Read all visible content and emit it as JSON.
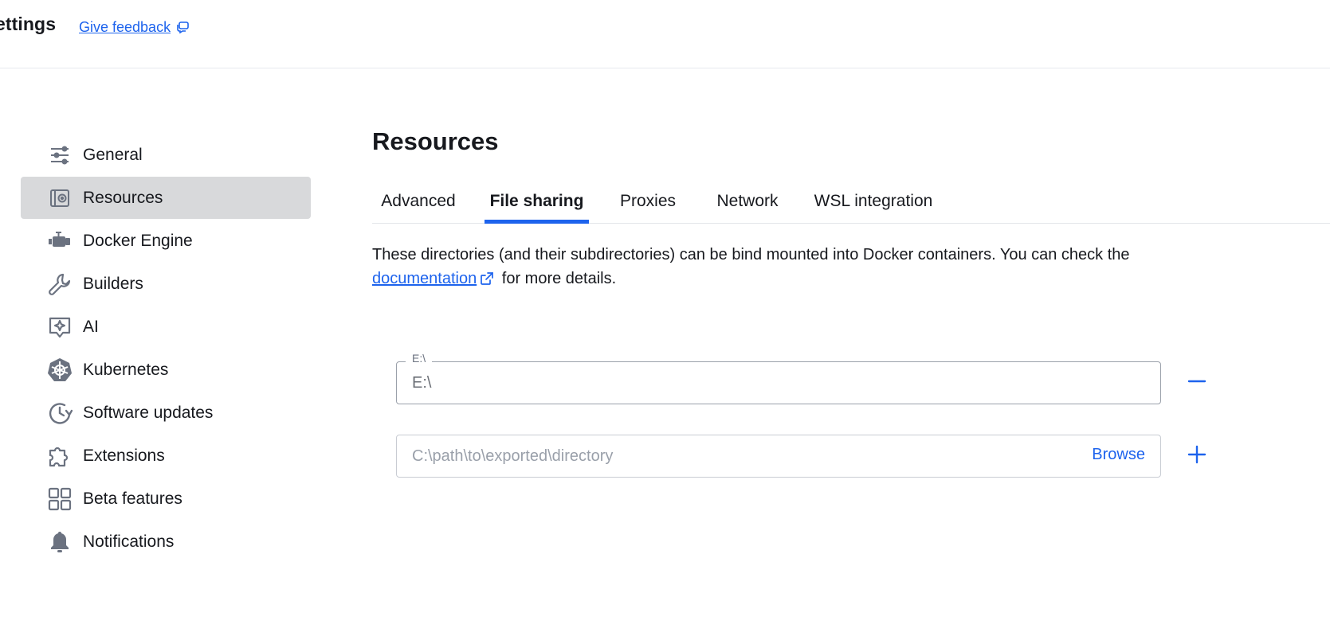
{
  "header": {
    "title": "ettings",
    "feedback_label": "Give feedback"
  },
  "sidebar": {
    "items": [
      {
        "label": "General",
        "icon": "sliders-icon",
        "active": false
      },
      {
        "label": "Resources",
        "icon": "resources-icon",
        "active": true
      },
      {
        "label": "Docker Engine",
        "icon": "engine-icon",
        "active": false
      },
      {
        "label": "Builders",
        "icon": "wrench-icon",
        "active": false
      },
      {
        "label": "AI",
        "icon": "ai-icon",
        "active": false
      },
      {
        "label": "Kubernetes",
        "icon": "kubernetes-icon",
        "active": false
      },
      {
        "label": "Software updates",
        "icon": "clock-refresh-icon",
        "active": false
      },
      {
        "label": "Extensions",
        "icon": "puzzle-icon",
        "active": false
      },
      {
        "label": "Beta features",
        "icon": "grid-icon",
        "active": false
      },
      {
        "label": "Notifications",
        "icon": "bell-icon",
        "active": false
      }
    ]
  },
  "main": {
    "title": "Resources",
    "tabs": [
      {
        "label": "Advanced",
        "active": false
      },
      {
        "label": "File sharing",
        "active": true
      },
      {
        "label": "Proxies",
        "active": false
      },
      {
        "label": "Network",
        "active": false
      },
      {
        "label": "WSL integration",
        "active": false
      }
    ],
    "description_before": "These directories (and their subdirectories) can be bind mounted into Docker containers. You can check the ",
    "description_link": "documentation",
    "description_after": " for more details.",
    "shared_dir": {
      "legend": "E:\\",
      "value": "E:\\"
    },
    "new_dir": {
      "placeholder": "C:\\path\\to\\exported\\directory",
      "browse_label": "Browse"
    }
  },
  "colors": {
    "accent": "#1d63ed",
    "active_nav_bg": "#d8d9db",
    "icon_gray": "#6b7280"
  }
}
